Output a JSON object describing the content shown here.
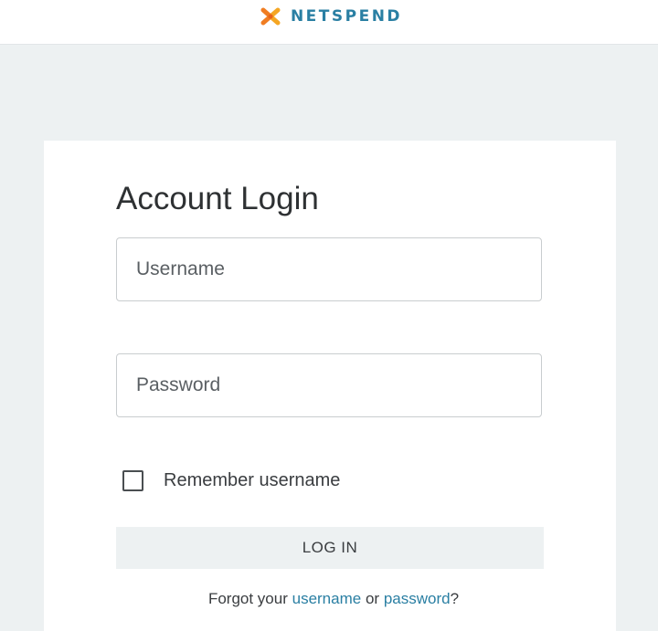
{
  "header": {
    "brand_name": "NETSPEND",
    "logo_icon": "netspend-logo-icon",
    "brand_color": "#2a7fa3",
    "logo_accent_color": "#f07d22"
  },
  "login": {
    "title": "Account Login",
    "username_placeholder": "Username",
    "username_value": "",
    "password_placeholder": "Password",
    "password_value": "",
    "remember_label": "Remember username",
    "remember_checked": false,
    "login_button_label": "LOG IN",
    "forgot_prefix": "Forgot your",
    "forgot_username_link": "username",
    "forgot_middle": "or",
    "forgot_password_link": "password",
    "forgot_suffix": "?"
  }
}
